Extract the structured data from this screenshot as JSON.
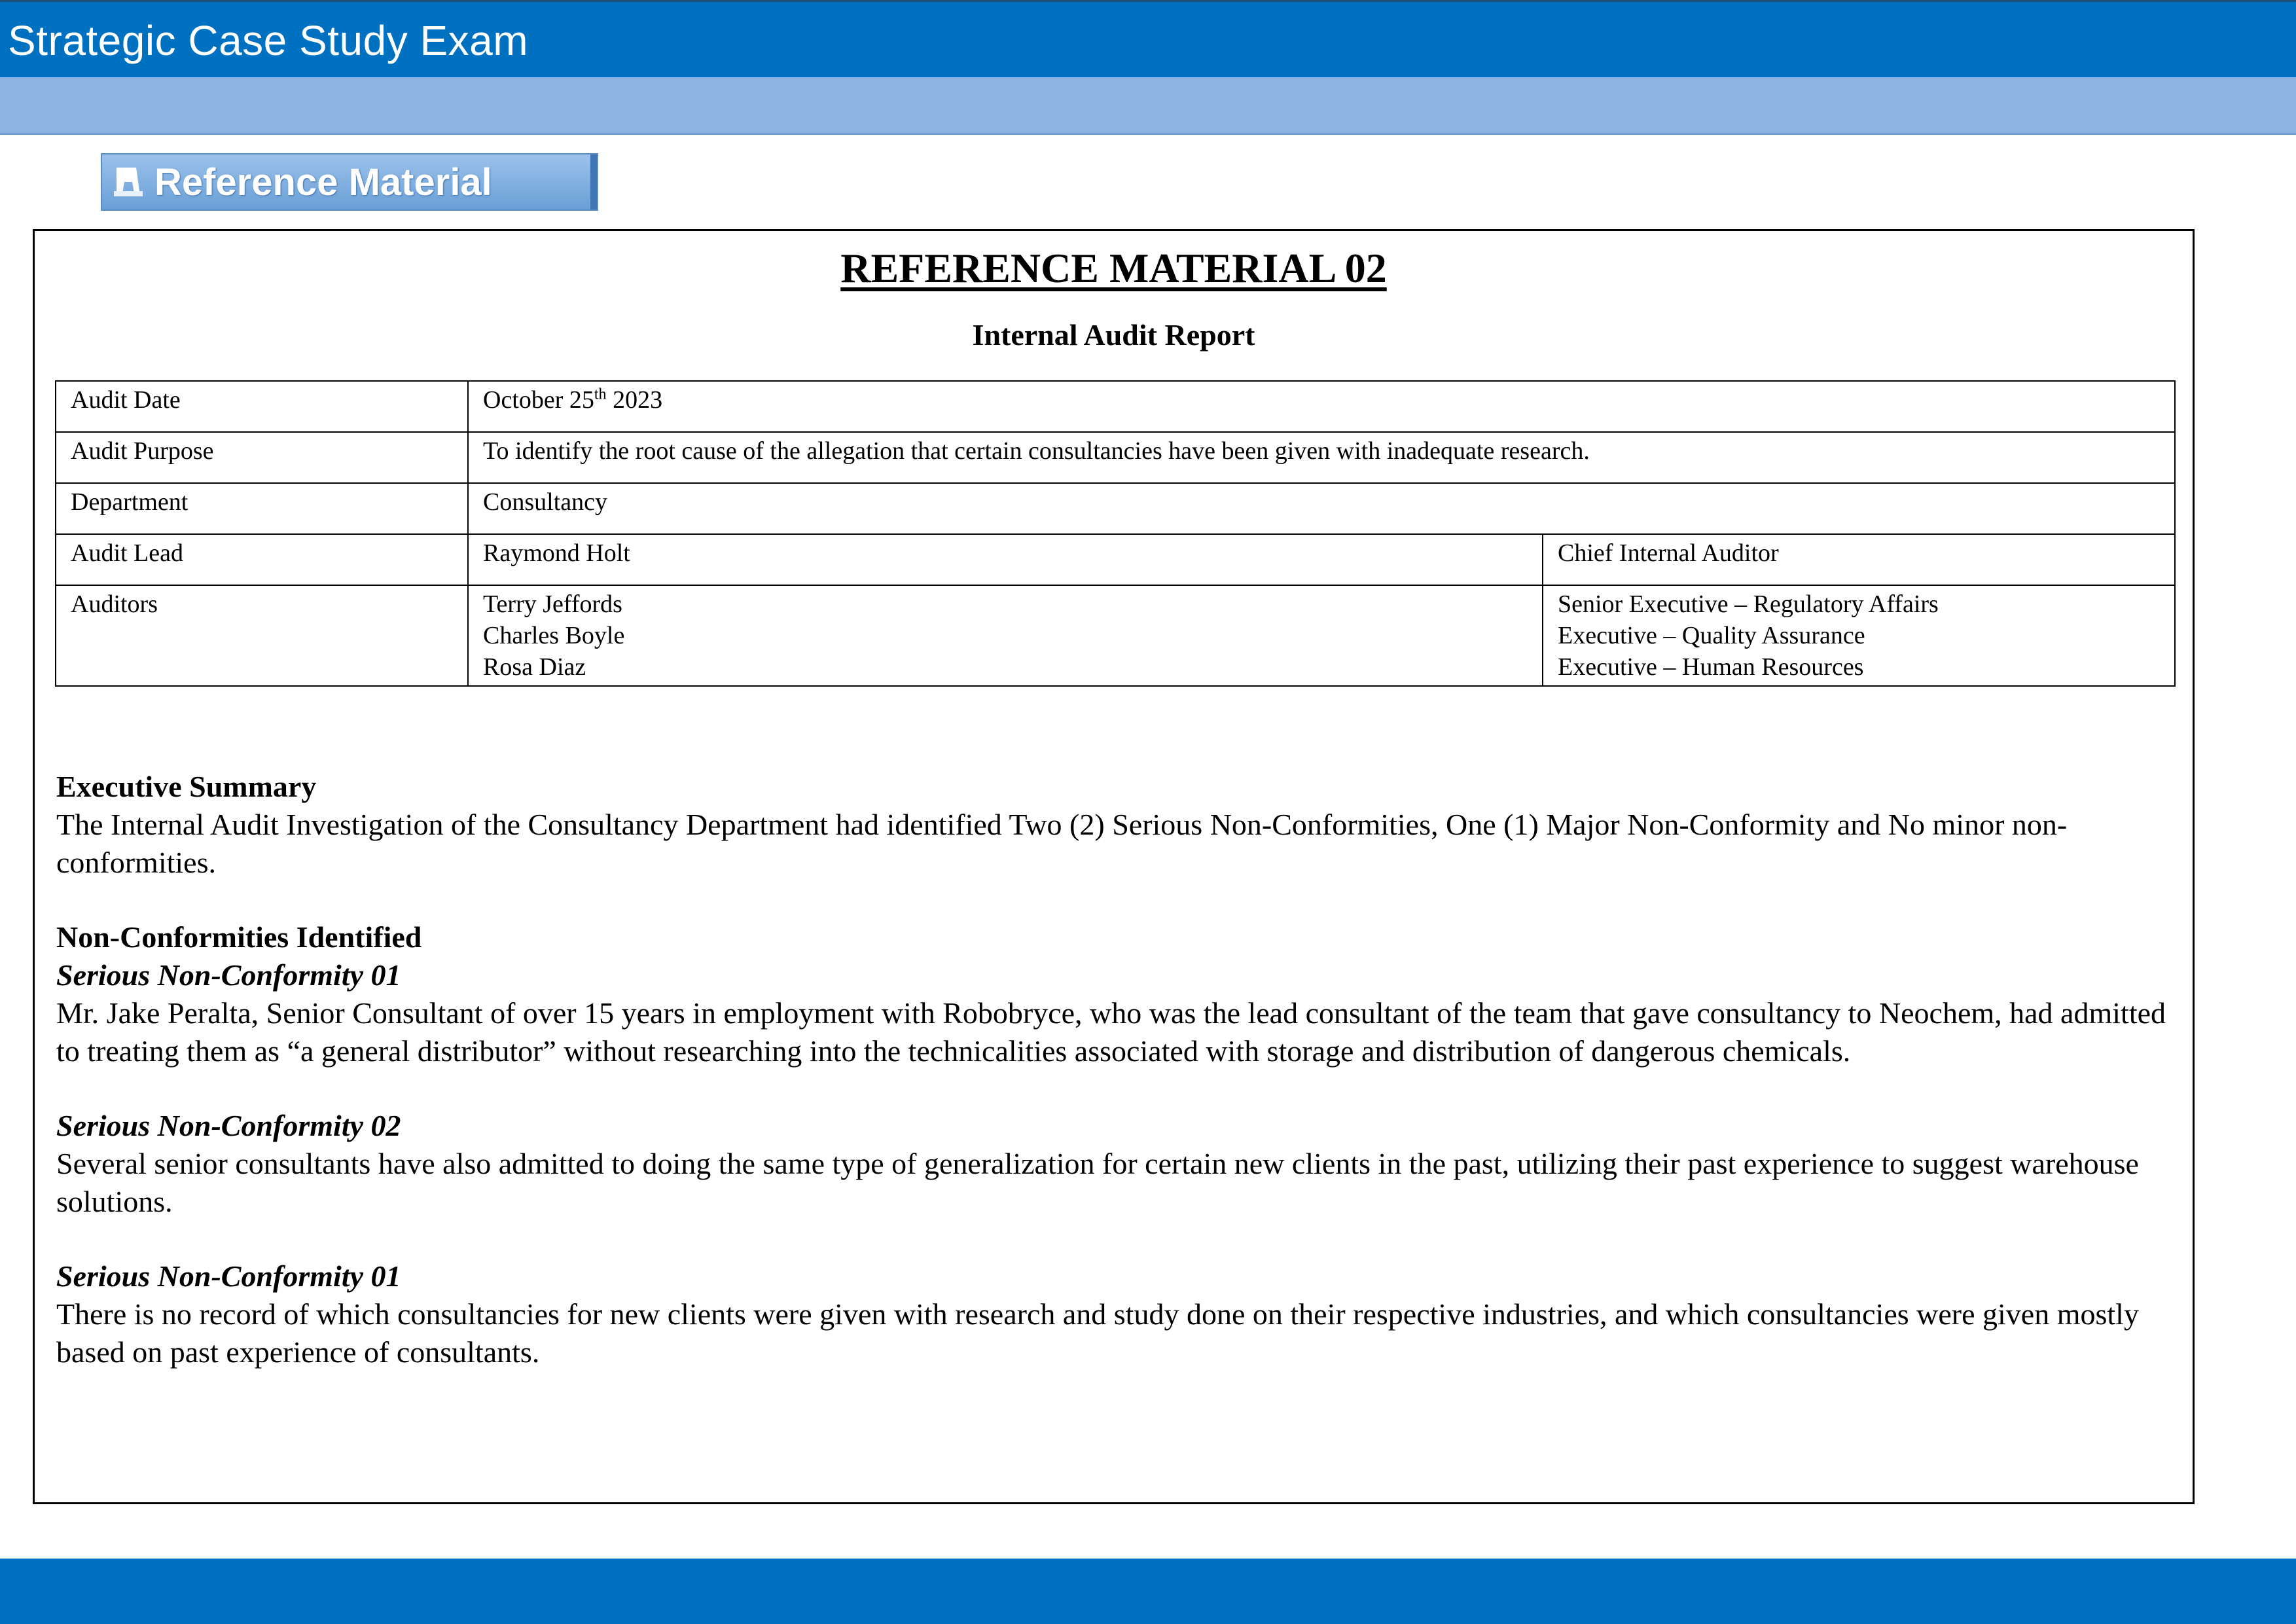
{
  "header": {
    "title": "Strategic Case Study Exam"
  },
  "toolbar": {
    "reference_button_label": "Reference Material",
    "reference_button_icon": "bookmark-icon"
  },
  "document": {
    "title": "REFERENCE MATERIAL 02",
    "subtitle": "Internal Audit Report",
    "table": {
      "audit_date_label": "Audit Date",
      "audit_date_value": "October 25",
      "audit_date_sup": "th",
      "audit_date_year": " 2023",
      "audit_purpose_label": "Audit Purpose",
      "audit_purpose_value": "To identify the root cause of the allegation that certain consultancies have been given with inadequate research.",
      "department_label": "Department",
      "department_value": "Consultancy",
      "audit_lead_label": "Audit Lead",
      "audit_lead_name": "Raymond Holt",
      "audit_lead_role": "Chief Internal Auditor",
      "auditors_label": "Auditors",
      "auditors": [
        {
          "name": "Terry Jeffords",
          "role": "Senior Executive – Regulatory Affairs"
        },
        {
          "name": "Charles Boyle",
          "role": "Executive – Quality Assurance"
        },
        {
          "name": "Rosa Diaz",
          "role": "Executive – Human Resources"
        }
      ]
    },
    "executive_summary": {
      "heading": "Executive Summary",
      "text": "The Internal Audit Investigation of the Consultancy Department had identified Two (2) Serious Non-Conformities, One (1) Major Non-Conformity and No minor non-conformities."
    },
    "non_conformities": {
      "heading": "Non-Conformities Identified",
      "items": [
        {
          "title": "Serious Non-Conformity 01",
          "text": "Mr. Jake Peralta, Senior Consultant of over 15 years in employment with Robobryce, who was the lead consultant of the team that gave consultancy to Neochem, had admitted to treating them as “a general distributor” without researching into the technicalities associated with storage and distribution of dangerous chemicals."
        },
        {
          "title": "Serious Non-Conformity 02",
          "text": "Several senior consultants have also admitted to doing the same type of generalization for certain new clients in the past, utilizing their past experience to suggest warehouse solutions."
        },
        {
          "title": "Serious Non-Conformity 01",
          "text": "There is no record of which consultancies for new clients were given with research and study done on their respective industries, and which consultancies were given mostly based on past experience of consultants."
        }
      ]
    }
  },
  "colors": {
    "header_blue": "#0070c0",
    "subbar_blue": "#8db3e2"
  }
}
